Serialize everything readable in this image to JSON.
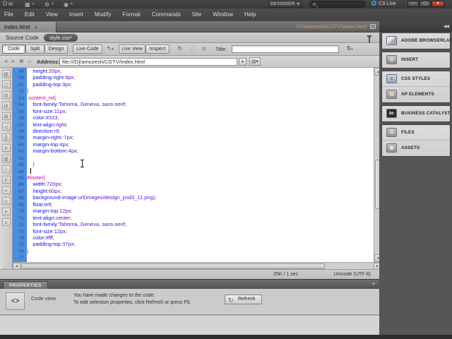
{
  "app": {
    "logo": "Dw",
    "workspace_button": "DESIGNER",
    "cs_live_label": "CS Live",
    "window_buttons": {
      "minimize": "—",
      "restore": "▢",
      "close": "x"
    },
    "menus": [
      "File",
      "Edit",
      "View",
      "Insert",
      "Modify",
      "Format",
      "Commands",
      "Site",
      "Window",
      "Help"
    ]
  },
  "tabbar": {
    "tab_label": "index.html",
    "tab_close": "x",
    "doc_path": "D:\\amozesh\\CGTV\\index.html"
  },
  "related_files": {
    "source_code_label": "Source Code",
    "active_file": "style.css*"
  },
  "doc_toolbar": {
    "code": "Code",
    "split": "Split",
    "design": "Design",
    "live_code": "Live Code",
    "live_view": "Live View",
    "inspect": "Inspect",
    "title_label": "Title:",
    "title_value": ""
  },
  "nav_bar": {
    "address_label": "Address:",
    "address_value": "file:///D|/amozesh/CGTV/index.html"
  },
  "status_bar": {
    "size_time": "25K / 1 sec",
    "encoding": "Unicode (UTF-8)"
  },
  "properties_panel": {
    "header": "PROPERTIES",
    "view_icon": "<>",
    "view_label": "Code view",
    "message_line1": "You have made changes to the code.",
    "message_line2": "To edit selection properties, click Refresh or press F5.",
    "refresh_button": "Refresh"
  },
  "dock": {
    "groups": [
      {
        "items": [
          {
            "name": "adobe-browserlab",
            "label": "ADOBE BROWSERLAB",
            "style": "abl",
            "glyph": ""
          }
        ]
      },
      {
        "items": [
          {
            "name": "insert",
            "label": "INSERT",
            "style": "",
            "glyph": "⊞"
          }
        ]
      },
      {
        "items": [
          {
            "name": "css-styles",
            "label": "CSS STYLES",
            "style": "css",
            "glyph": "≡"
          },
          {
            "name": "ap-elements",
            "label": "AP ELEMENTS",
            "style": "",
            "glyph": "▤"
          }
        ]
      },
      {
        "items": [
          {
            "name": "business-catalyst",
            "label": "BUSINESS CATALYST",
            "style": "bc",
            "glyph": "bc"
          }
        ]
      },
      {
        "items": [
          {
            "name": "files",
            "label": "FILES",
            "style": "",
            "glyph": "品"
          },
          {
            "name": "assets",
            "label": "ASSETS",
            "style": "",
            "glyph": "▦"
          }
        ]
      }
    ]
  },
  "coding_toolbar_icons": [
    {
      "name": "open-documents-icon",
      "glyph": "▤"
    },
    {
      "name": "show-code-navigator-icon",
      "glyph": "▢"
    },
    {
      "name": "collapse-full-tag-icon",
      "glyph": "⊟"
    },
    {
      "name": "collapse-selection-icon",
      "glyph": "⊟"
    },
    {
      "name": "expand-all-icon",
      "glyph": "⊞"
    },
    {
      "name": "select-parent-tag-icon",
      "glyph": "◁"
    },
    {
      "name": "balance-braces-icon",
      "glyph": "{}"
    },
    {
      "name": "line-numbers-icon",
      "glyph": "#"
    },
    {
      "name": "highlight-invalid-code-icon",
      "glyph": "▥"
    },
    {
      "name": "syntax-error-alerts-icon",
      "glyph": "!"
    },
    {
      "name": "apply-comment-icon",
      "glyph": "//"
    },
    {
      "name": "remove-comment-icon",
      "glyph": "×"
    },
    {
      "name": "wrap-tag-icon",
      "glyph": "◇"
    },
    {
      "name": "recent-snippets-icon",
      "glyph": "≡"
    },
    {
      "name": "move-convert-css-icon",
      "glyph": "±"
    }
  ],
  "code": {
    "lines": [
      {
        "n": 49,
        "seg": [
          [
            "w",
            "    "
          ],
          [
            "p",
            "height"
          ],
          [
            "o",
            ":"
          ],
          [
            "v",
            "20px"
          ],
          [
            "o",
            ";"
          ]
        ]
      },
      {
        "n": 50,
        "seg": [
          [
            "w",
            "    "
          ],
          [
            "p",
            "padding-right"
          ],
          [
            "o",
            ":"
          ],
          [
            "v",
            "6px"
          ],
          [
            "o",
            ";"
          ]
        ]
      },
      {
        "n": 51,
        "seg": [
          [
            "w",
            "    "
          ],
          [
            "p",
            "padding-top"
          ],
          [
            "o",
            ":"
          ],
          [
            "v",
            "3px"
          ],
          [
            "o",
            ";"
          ]
        ]
      },
      {
        "n": 52,
        "seg": [
          [
            "b",
            "}"
          ]
        ]
      },
      {
        "n": 53,
        "seg": [
          [
            "s",
            ".content_txt{"
          ]
        ]
      },
      {
        "n": 54,
        "seg": [
          [
            "w",
            "    "
          ],
          [
            "p",
            "font-family"
          ],
          [
            "o",
            ":"
          ],
          [
            "v",
            "Tahoma, Geneva, sans-serif"
          ],
          [
            "o",
            ";"
          ]
        ]
      },
      {
        "n": 55,
        "seg": [
          [
            "w",
            "    "
          ],
          [
            "p",
            "font-size"
          ],
          [
            "o",
            ":"
          ],
          [
            "v",
            "11px"
          ],
          [
            "o",
            ";"
          ]
        ]
      },
      {
        "n": 56,
        "seg": [
          [
            "w",
            "    "
          ],
          [
            "p",
            "color"
          ],
          [
            "o",
            ":"
          ],
          [
            "v",
            "#333"
          ],
          [
            "o",
            ";"
          ]
        ]
      },
      {
        "n": 57,
        "seg": [
          [
            "w",
            "    "
          ],
          [
            "p",
            "text-align"
          ],
          [
            "o",
            ":"
          ],
          [
            "v",
            "right"
          ],
          [
            "o",
            ";"
          ]
        ]
      },
      {
        "n": 58,
        "seg": [
          [
            "w",
            "    "
          ],
          [
            "p",
            "direction"
          ],
          [
            "o",
            ":"
          ],
          [
            "v",
            "rtl"
          ],
          [
            "o",
            ";"
          ]
        ]
      },
      {
        "n": 59,
        "seg": [
          [
            "w",
            "    "
          ],
          [
            "p",
            "margin-right"
          ],
          [
            "o",
            "::"
          ],
          [
            "v",
            "7px"
          ],
          [
            "o",
            ";"
          ]
        ]
      },
      {
        "n": 60,
        "seg": [
          [
            "w",
            "    "
          ],
          [
            "p",
            "margin-top"
          ],
          [
            "o",
            ":"
          ],
          [
            "v",
            "4px"
          ],
          [
            "o",
            ";"
          ]
        ]
      },
      {
        "n": 61,
        "seg": [
          [
            "w",
            "    "
          ],
          [
            "p",
            "margin-bottom"
          ],
          [
            "o",
            ":"
          ],
          [
            "v",
            "4px"
          ],
          [
            "o",
            ";"
          ]
        ]
      },
      {
        "n": 62,
        "seg": []
      },
      {
        "n": 63,
        "seg": [
          [
            "w",
            "    "
          ],
          [
            "b",
            "}"
          ]
        ]
      },
      {
        "n": 64,
        "seg": [],
        "caret": true
      },
      {
        "n": 65,
        "seg": [
          [
            "s",
            "#footer{"
          ]
        ]
      },
      {
        "n": 66,
        "seg": [
          [
            "w",
            "    "
          ],
          [
            "p",
            "width"
          ],
          [
            "o",
            ":"
          ],
          [
            "v",
            "720px"
          ],
          [
            "o",
            ";"
          ]
        ]
      },
      {
        "n": 67,
        "seg": [
          [
            "w",
            "    "
          ],
          [
            "p",
            "height"
          ],
          [
            "o",
            ":"
          ],
          [
            "v",
            "60px"
          ],
          [
            "o",
            ";"
          ]
        ]
      },
      {
        "n": 68,
        "seg": [
          [
            "w",
            "    "
          ],
          [
            "p",
            "background-image"
          ],
          [
            "o",
            ":"
          ],
          [
            "v",
            "url(images/design_psd3_11.png)"
          ],
          [
            "o",
            ";"
          ]
        ]
      },
      {
        "n": 69,
        "seg": [
          [
            "w",
            "    "
          ],
          [
            "p",
            "float"
          ],
          [
            "o",
            ":"
          ],
          [
            "v",
            "left"
          ],
          [
            "o",
            ";"
          ]
        ]
      },
      {
        "n": 70,
        "seg": [
          [
            "w",
            "    "
          ],
          [
            "p",
            "margin-top"
          ],
          [
            "o",
            ":"
          ],
          [
            "v",
            "12px"
          ],
          [
            "o",
            ";"
          ]
        ]
      },
      {
        "n": 71,
        "seg": [
          [
            "w",
            "    "
          ],
          [
            "p",
            "text-align"
          ],
          [
            "o",
            ":"
          ],
          [
            "v",
            "center"
          ],
          [
            "o",
            ";"
          ]
        ]
      },
      {
        "n": 72,
        "seg": [
          [
            "w",
            "    "
          ],
          [
            "p",
            "font-family"
          ],
          [
            "o",
            ":"
          ],
          [
            "v",
            "Tahoma, Geneva, sans-serif"
          ],
          [
            "o",
            ";"
          ]
        ]
      },
      {
        "n": 73,
        "seg": [
          [
            "w",
            "    "
          ],
          [
            "p",
            "font-size"
          ],
          [
            "o",
            ":"
          ],
          [
            "v",
            "12px"
          ],
          [
            "o",
            ";"
          ]
        ]
      },
      {
        "n": 74,
        "seg": [
          [
            "w",
            "    "
          ],
          [
            "p",
            "color"
          ],
          [
            "o",
            ":"
          ],
          [
            "v",
            "#fff"
          ],
          [
            "o",
            ";"
          ]
        ]
      },
      {
        "n": 75,
        "seg": [
          [
            "w",
            "    "
          ],
          [
            "p",
            "padding-top"
          ],
          [
            "o",
            ":"
          ],
          [
            "v",
            "37px"
          ],
          [
            "o",
            ";"
          ]
        ]
      },
      {
        "n": 76,
        "seg": [
          [
            "b",
            "}"
          ]
        ]
      },
      {
        "n": 77,
        "seg": []
      }
    ]
  },
  "colors": {
    "selector": "#e0009c",
    "property": "#1414d8",
    "value": "#5a10c8",
    "gutter_bg": "#4a8ede",
    "accent_cs_live": "#2fa3dc",
    "close_button": "#b5342c"
  }
}
